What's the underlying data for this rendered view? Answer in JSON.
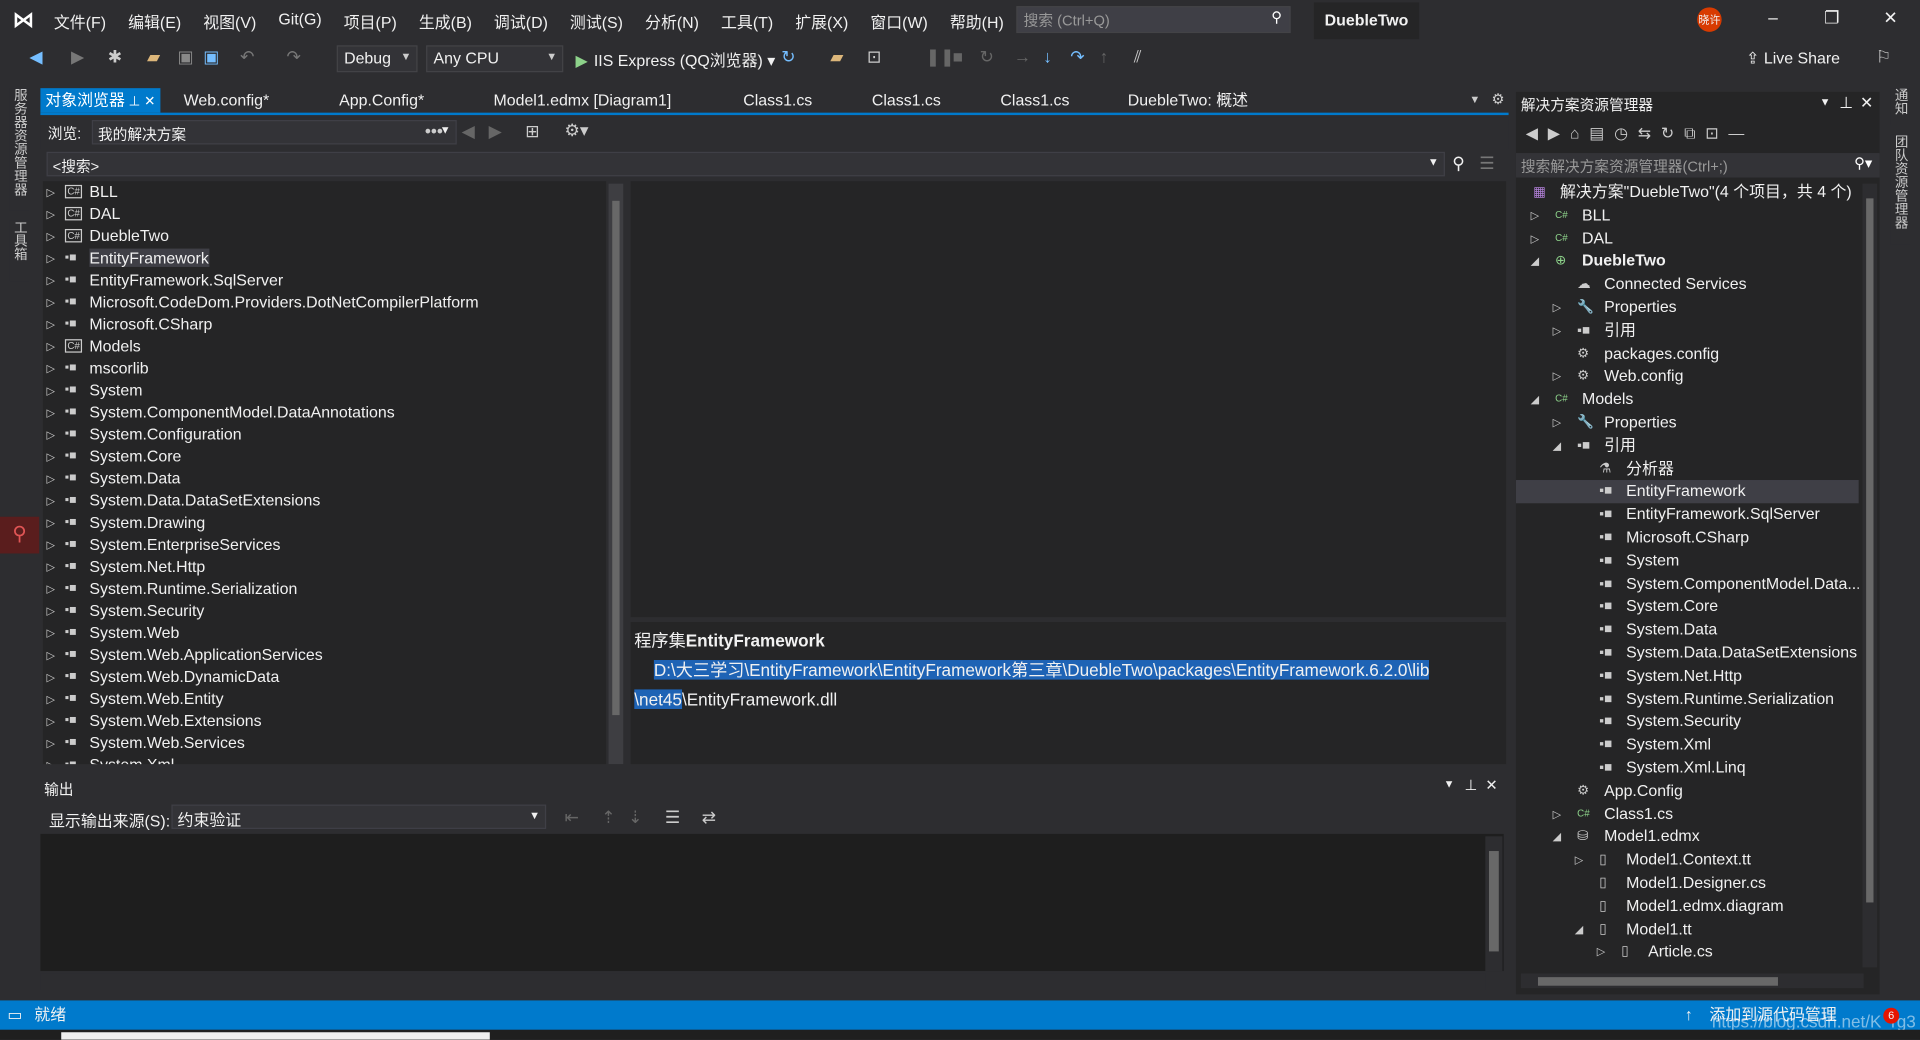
{
  "menubar": {
    "items": [
      "文件(F)",
      "编辑(E)",
      "视图(V)",
      "Git(G)",
      "项目(P)",
      "生成(B)",
      "调试(D)",
      "测试(S)",
      "分析(N)",
      "工具(T)",
      "扩展(X)",
      "窗口(W)",
      "帮助(H)"
    ],
    "search_placeholder": "搜索 (Ctrl+Q)",
    "solution_name": "DuebleTwo",
    "avatar": "晓许"
  },
  "toolbar": {
    "config": "Debug",
    "platform": "Any CPU",
    "run": "IIS Express (QQ浏览器)",
    "live_share": "Live Share"
  },
  "left_strip": {
    "server_explorer": "服务器资源管理器",
    "toolbox": "工具箱"
  },
  "right_strip": {
    "notifications": "通知",
    "team_explorer": "团队资源管理器"
  },
  "tabs": [
    {
      "label": "对象浏览器",
      "active": true
    },
    {
      "label": "Web.config*"
    },
    {
      "label": "App.Config*"
    },
    {
      "label": "Model1.edmx [Diagram1]"
    },
    {
      "label": "Class1.cs"
    },
    {
      "label": "Class1.cs"
    },
    {
      "label": "Class1.cs"
    },
    {
      "label": "DuebleTwo: 概述"
    }
  ],
  "object_browser": {
    "browse_label": "浏览:",
    "browse_value": "我的解决方案",
    "search": "<搜索>",
    "items": [
      "BLL",
      "DAL",
      "DuebleTwo",
      "EntityFramework",
      "EntityFramework.SqlServer",
      "Microsoft.CodeDom.Providers.DotNetCompilerPlatform",
      "Microsoft.CSharp",
      "Models",
      "mscorlib",
      "System",
      "System.ComponentModel.DataAnnotations",
      "System.Configuration",
      "System.Core",
      "System.Data",
      "System.Data.DataSetExtensions",
      "System.Drawing",
      "System.EnterpriseServices",
      "System.Net.Http",
      "System.Runtime.Serialization",
      "System.Security",
      "System.Web",
      "System.Web.ApplicationServices",
      "System.Web.DynamicData",
      "System.Web.Entity",
      "System.Web.Extensions",
      "System.Web.Services",
      "System.Xml"
    ],
    "selected": "EntityFramework",
    "desc_prefix": "程序集",
    "desc_name": "EntityFramework",
    "path_selected_1": "D:\\大三学习\\EntityFramework\\EntityFramework第三章\\DuebleTwo\\packages\\EntityFramework.6.2.0\\lib",
    "path_selected_2": "\\net45",
    "path_rest": "\\EntityFramework.dll"
  },
  "output": {
    "title": "输出",
    "source_label": "显示输出来源(S):",
    "source_value": "约束验证"
  },
  "solution_explorer": {
    "title": "解决方案资源管理器",
    "search_placeholder": "搜索解决方案资源管理器(Ctrl+;)",
    "items": [
      {
        "label": "解决方案\"DuebleTwo\"(4 个项目，共 4 个)",
        "level": 0,
        "tw": "",
        "icon": "solution"
      },
      {
        "label": "BLL",
        "level": 0,
        "tw": "▷",
        "icon": "cs"
      },
      {
        "label": "DAL",
        "level": 0,
        "tw": "▷",
        "icon": "cs"
      },
      {
        "label": "DuebleTwo",
        "level": 0,
        "tw": "◢",
        "icon": "web",
        "bold": true
      },
      {
        "label": "Connected Services",
        "level": 1,
        "tw": "",
        "icon": "cloud"
      },
      {
        "label": "Properties",
        "level": 1,
        "tw": "▷",
        "icon": "wrench"
      },
      {
        "label": "引用",
        "level": 1,
        "tw": "▷",
        "icon": "ref"
      },
      {
        "label": "packages.config",
        "level": 1,
        "tw": "",
        "icon": "config"
      },
      {
        "label": "Web.config",
        "level": 1,
        "tw": "▷",
        "icon": "config"
      },
      {
        "label": "Models",
        "level": 0,
        "tw": "◢",
        "icon": "cs"
      },
      {
        "label": "Properties",
        "level": 1,
        "tw": "▷",
        "icon": "wrench"
      },
      {
        "label": "引用",
        "level": 1,
        "tw": "◢",
        "icon": "ref"
      },
      {
        "label": "分析器",
        "level": 2,
        "tw": "",
        "icon": "analyzer"
      },
      {
        "label": "EntityFramework",
        "level": 2,
        "tw": "",
        "icon": "ref",
        "selected": true
      },
      {
        "label": "EntityFramework.SqlServer",
        "level": 2,
        "tw": "",
        "icon": "ref"
      },
      {
        "label": "Microsoft.CSharp",
        "level": 2,
        "tw": "",
        "icon": "ref"
      },
      {
        "label": "System",
        "level": 2,
        "tw": "",
        "icon": "ref"
      },
      {
        "label": "System.ComponentModel.Data...",
        "level": 2,
        "tw": "",
        "icon": "ref"
      },
      {
        "label": "System.Core",
        "level": 2,
        "tw": "",
        "icon": "ref"
      },
      {
        "label": "System.Data",
        "level": 2,
        "tw": "",
        "icon": "ref"
      },
      {
        "label": "System.Data.DataSetExtensions",
        "level": 2,
        "tw": "",
        "icon": "ref"
      },
      {
        "label": "System.Net.Http",
        "level": 2,
        "tw": "",
        "icon": "ref"
      },
      {
        "label": "System.Runtime.Serialization",
        "level": 2,
        "tw": "",
        "icon": "ref"
      },
      {
        "label": "System.Security",
        "level": 2,
        "tw": "",
        "icon": "ref"
      },
      {
        "label": "System.Xml",
        "level": 2,
        "tw": "",
        "icon": "ref"
      },
      {
        "label": "System.Xml.Linq",
        "level": 2,
        "tw": "",
        "icon": "ref"
      },
      {
        "label": "App.Config",
        "level": 1,
        "tw": "",
        "icon": "config"
      },
      {
        "label": "Class1.cs",
        "level": 1,
        "tw": "▷",
        "icon": "csfile"
      },
      {
        "label": "Model1.edmx",
        "level": 1,
        "tw": "◢",
        "icon": "edmx"
      },
      {
        "label": "Model1.Context.tt",
        "level": 2,
        "tw": "▷",
        "icon": "file"
      },
      {
        "label": "Model1.Designer.cs",
        "level": 2,
        "tw": "",
        "icon": "file"
      },
      {
        "label": "Model1.edmx.diagram",
        "level": 2,
        "tw": "",
        "icon": "file"
      },
      {
        "label": "Model1.tt",
        "level": 2,
        "tw": "◢",
        "icon": "file"
      },
      {
        "label": "Article.cs",
        "level": 3,
        "tw": "▷",
        "icon": "file"
      }
    ]
  },
  "status": {
    "text": "就绪",
    "source_control": "添加到源代码管理",
    "watermark": "https://blog.csdn.net/K_rg3",
    "notification_count": "6"
  },
  "colors": {
    "accent": "#007acc",
    "background": "#2d2d30",
    "panel": "#252526",
    "selection": "#1e63b5"
  }
}
